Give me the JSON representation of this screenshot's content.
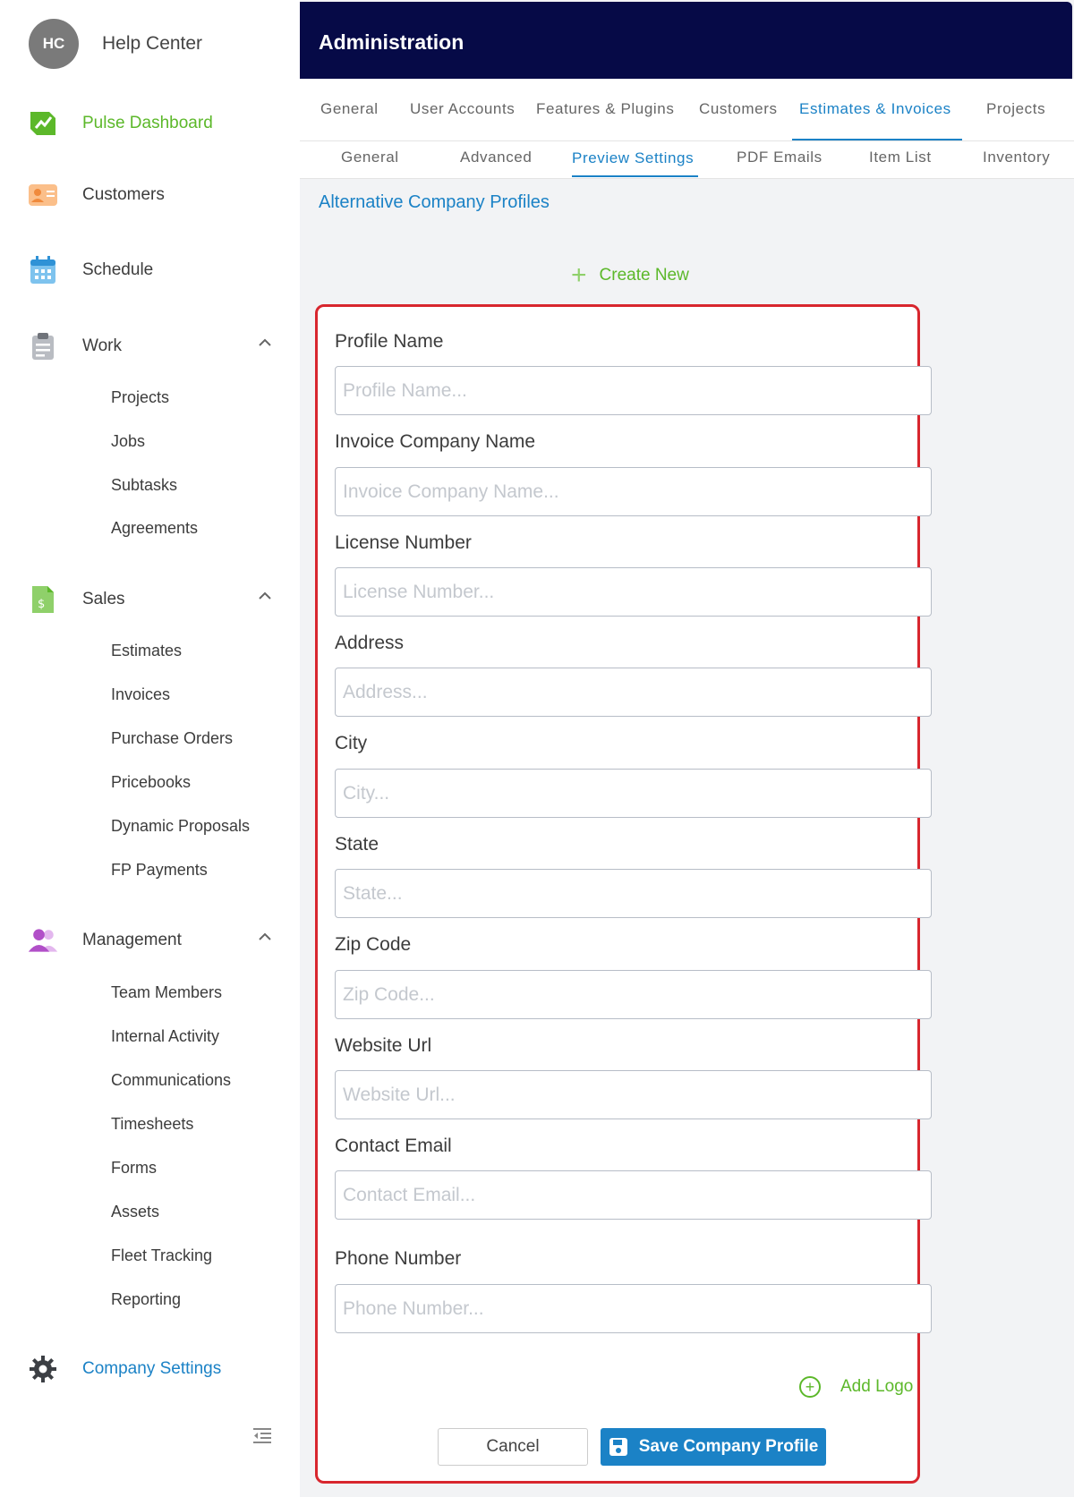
{
  "sidebar": {
    "profile": {
      "initials": "HC",
      "name": "Help Center"
    },
    "items": [
      {
        "label": "Pulse Dashboard"
      },
      {
        "label": "Customers"
      },
      {
        "label": "Schedule"
      },
      {
        "label": "Work",
        "children": [
          "Projects",
          "Jobs",
          "Subtasks",
          "Agreements"
        ]
      },
      {
        "label": "Sales",
        "children": [
          "Estimates",
          "Invoices",
          "Purchase Orders",
          "Pricebooks",
          "Dynamic Proposals",
          "FP Payments"
        ]
      },
      {
        "label": "Management",
        "children": [
          "Team Members",
          "Internal Activity",
          "Communications",
          "Timesheets",
          "Forms",
          "Assets",
          "Fleet Tracking",
          "Reporting"
        ]
      },
      {
        "label": "Company Settings"
      }
    ]
  },
  "header": {
    "title": "Administration"
  },
  "tabs_primary": [
    "General",
    "User Accounts",
    "Features & Plugins",
    "Customers",
    "Estimates & Invoices",
    "Projects"
  ],
  "tabs_secondary": [
    "General",
    "Advanced",
    "Preview Settings",
    "PDF Emails",
    "Item List",
    "Inventory"
  ],
  "section": {
    "title": "Alternative Company Profiles",
    "create_new": "Create New"
  },
  "form": {
    "fields": [
      {
        "label": "Profile Name",
        "placeholder": "Profile Name..."
      },
      {
        "label": "Invoice Company Name",
        "placeholder": "Invoice Company Name..."
      },
      {
        "label": "License Number",
        "placeholder": "License Number..."
      },
      {
        "label": "Address",
        "placeholder": "Address..."
      },
      {
        "label": "City",
        "placeholder": "City..."
      },
      {
        "label": "State",
        "placeholder": "State..."
      },
      {
        "label": "Zip Code",
        "placeholder": "Zip Code..."
      },
      {
        "label": "Website Url",
        "placeholder": "Website Url..."
      },
      {
        "label": "Contact Email",
        "placeholder": "Contact Email..."
      },
      {
        "label": "Phone Number",
        "placeholder": "Phone Number..."
      }
    ],
    "add_logo": "Add Logo",
    "cancel": "Cancel",
    "save": "Save Company Profile"
  },
  "colors": {
    "accent": "#1b82c6",
    "green": "#5cb82a",
    "header": "#060a47",
    "highlight_border": "#d8262e"
  }
}
